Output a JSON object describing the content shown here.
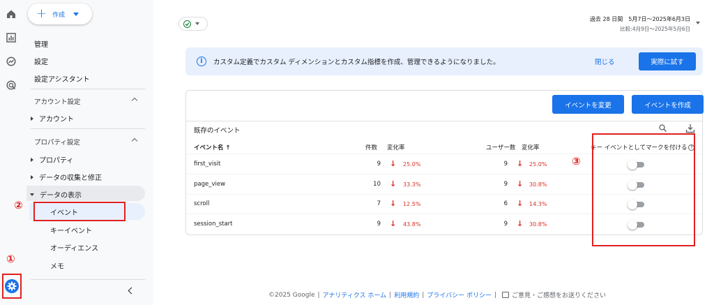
{
  "rail": {
    "icons": [
      "home-icon",
      "reports-icon",
      "explore-icon",
      "advertising-icon"
    ],
    "settings_icon": "gear-icon"
  },
  "markers": {
    "one": "①",
    "two": "②",
    "three": "③"
  },
  "sidebar": {
    "create_label": "作成",
    "top_items": [
      "管理",
      "設定",
      "設定アシスタント"
    ],
    "account_header": "アカウント設定",
    "account_items": [
      "アカウント"
    ],
    "property_header": "プロパティ設定",
    "property_items": [
      "プロパティ",
      "データの収集と修正"
    ],
    "data_display_label": "データの表示",
    "data_display_items": [
      "イベント",
      "キーイベント",
      "オーディエンス",
      "メモ"
    ]
  },
  "topbar": {
    "date_range": "過去 28 日間　5月7日～2025年6月3日",
    "date_compare": "比較:4月9日～2025年5月6日"
  },
  "banner": {
    "text": "カスタム定義でカスタム ディメンションとカスタム指標を作成、管理できるようになりました。",
    "close_label": "閉じる",
    "try_label": "実際に試す"
  },
  "card": {
    "modify_button": "イベントを変更",
    "create_button": "イベントを作成",
    "title": "既存のイベント",
    "columns": {
      "event_name": "イベント名 ↑",
      "count": "件数",
      "count_change": "変化率",
      "users": "ユーザー数",
      "users_change": "変化率",
      "mark_key": "キー イベントとしてマークを付ける",
      "help": "?"
    },
    "rows": [
      {
        "name": "first_visit",
        "count": "9",
        "count_change": "25.0%",
        "users": "9",
        "users_change": "25.0%"
      },
      {
        "name": "page_view",
        "count": "10",
        "count_change": "33.3%",
        "users": "9",
        "users_change": "30.8%"
      },
      {
        "name": "scroll",
        "count": "7",
        "count_change": "12.5%",
        "users": "6",
        "users_change": "14.3%"
      },
      {
        "name": "session_start",
        "count": "9",
        "count_change": "43.8%",
        "users": "9",
        "users_change": "30.8%"
      }
    ]
  },
  "footer": {
    "copyright": "©2025 Google",
    "analytics_home": "アナリティクス ホーム",
    "terms": "利用規約",
    "privacy": "プライバシー ポリシー",
    "feedback": "ご意見・ご感想をお送りください",
    "separator": "|"
  },
  "colors": {
    "accent": "#1a73e8",
    "alert_red": "#d93025",
    "annotation_red": "#e02020",
    "banner_bg": "#e8f0fe"
  }
}
